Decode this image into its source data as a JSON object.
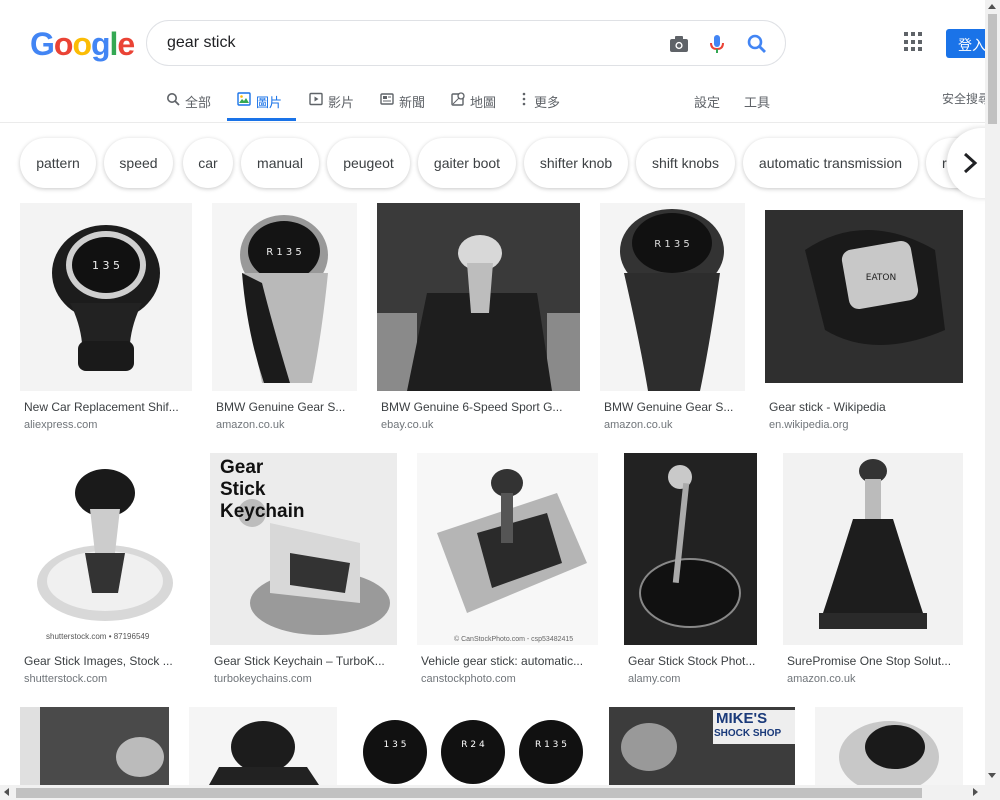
{
  "header": {
    "logo": [
      "G",
      "o",
      "o",
      "g",
      "l",
      "e"
    ],
    "logo_colors": [
      "#4285f4",
      "#ea4335",
      "#fbbc05",
      "#4285f4",
      "#34a853",
      "#ea4335"
    ],
    "query": "gear stick",
    "signin_label": "登入"
  },
  "tabs": [
    {
      "label": "全部",
      "icon": "search-icon"
    },
    {
      "label": "圖片",
      "icon": "image-icon",
      "active": true
    },
    {
      "label": "影片",
      "icon": "video-icon"
    },
    {
      "label": "新聞",
      "icon": "news-icon"
    },
    {
      "label": "地圖",
      "icon": "map-icon"
    },
    {
      "label": "更多",
      "icon": "more-icon"
    }
  ],
  "tools": {
    "settings": "設定",
    "tools": "工具",
    "safesearch": "安全搜尋"
  },
  "chips": [
    "pattern",
    "speed",
    "car",
    "manual",
    "peugeot",
    "gaiter boot",
    "shifter knob",
    "shift knobs",
    "automatic transmission",
    "r"
  ],
  "results": [
    {
      "caption": "New Car Replacement Shif...",
      "source": "aliexpress.com"
    },
    {
      "caption": "BMW Genuine Gear S...",
      "source": "amazon.co.uk"
    },
    {
      "caption": "BMW Genuine 6-Speed Sport G...",
      "source": "ebay.co.uk"
    },
    {
      "caption": "BMW Genuine Gear S...",
      "source": "amazon.co.uk"
    },
    {
      "caption": "Gear stick - Wikipedia",
      "source": "en.wikipedia.org"
    },
    {
      "caption": "Gear Stick Images, Stock ...",
      "source": "shutterstock.com"
    },
    {
      "caption": "Gear Stick Keychain – TurboK...",
      "source": "turbokeychains.com"
    },
    {
      "caption": "Vehicle gear stick: automatic...",
      "source": "canstockphoto.com"
    },
    {
      "caption": "Gear Stick Stock Phot...",
      "source": "alamy.com"
    },
    {
      "caption": "SurePromise One Stop Solut...",
      "source": "amazon.co.uk"
    }
  ],
  "image_text": {
    "keychain_title": "Gear Stick Keychain",
    "shutterstock_mark": "shutterstock.com • 87196549",
    "canstock_mark": "© CanStockPhoto.com - csp53482415",
    "mikes_sign": "MIKE'S",
    "mikes_sign2": "SHOCK SHOP"
  }
}
